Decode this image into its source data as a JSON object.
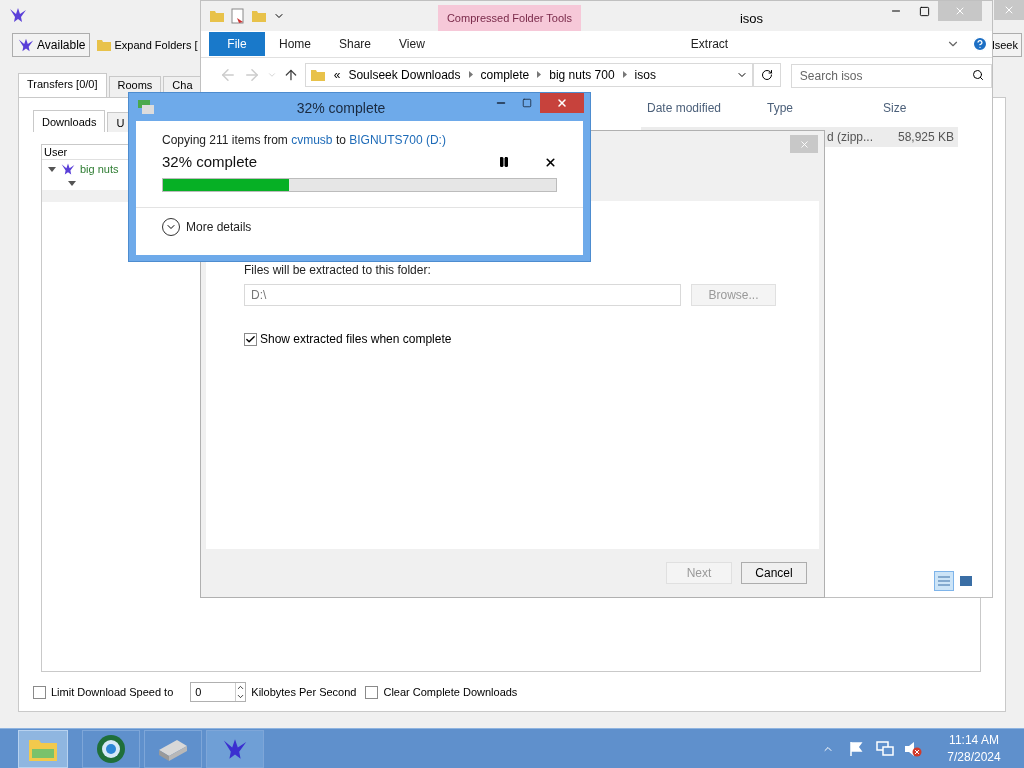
{
  "soulseek": {
    "status_button": "Available",
    "expand_button": "Expand Folders [",
    "right_button": "lseek",
    "tabs": [
      {
        "label": "Transfers [0/0]",
        "selected": true
      },
      {
        "label": "Rooms",
        "selected": false
      },
      {
        "label": "Cha",
        "selected": false
      }
    ],
    "subtabs": [
      {
        "label": "Downloads",
        "selected": true
      },
      {
        "label": "U",
        "selected": false
      }
    ],
    "table": {
      "columns": [
        "User"
      ],
      "rows": [
        {
          "user": "big nuts",
          "expanded": true,
          "children": [
            {
              "expanded": true
            }
          ]
        }
      ]
    },
    "limit_speed": {
      "label": "Limit Download Speed to",
      "checked": false
    },
    "speed_value": "0",
    "speed_unit": "Kilobytes Per Second",
    "clear_complete": {
      "label": "Clear Complete Downloads",
      "checked": false
    }
  },
  "explorer": {
    "title": "isos",
    "contextual_group": "Compressed Folder Tools",
    "ribbon_tabs": [
      {
        "label": "File",
        "kind": "file"
      },
      {
        "label": "Home",
        "kind": "tab"
      },
      {
        "label": "Share",
        "kind": "tab"
      },
      {
        "label": "View",
        "kind": "tab"
      },
      {
        "label": "Extract",
        "kind": "contextual"
      }
    ],
    "breadcrumb": [
      "«",
      "Soulseek Downloads",
      "complete",
      "big nuts 700",
      "isos"
    ],
    "search": {
      "placeholder": "Search isos"
    },
    "columns": [
      "Date modified",
      "Type",
      "Size"
    ],
    "row": {
      "type": "d (zipp...",
      "size": "58,925 KB"
    },
    "views": [
      {
        "kind": "details",
        "selected": true
      },
      {
        "kind": "large_icons",
        "selected": false
      }
    ]
  },
  "extract_wizard": {
    "prompt": "Files will be extracted to this folder:",
    "path": "D:\\",
    "browse": {
      "label": "Browse...",
      "disabled": true
    },
    "show_files": {
      "label": "Show extracted files when complete",
      "checked": true
    },
    "buttons": [
      {
        "label": "Next",
        "disabled": true
      },
      {
        "label": "Cancel",
        "disabled": false
      }
    ]
  },
  "copy_dialog": {
    "title": "32% complete",
    "message": {
      "prefix": "Copying 211 items from",
      "source": "cvmusb",
      "middle": "to",
      "destination": "BIGNUTS700 (D:)"
    },
    "status": "32% complete",
    "level": 0.32,
    "more_details": "More details"
  },
  "taskbar": {
    "time": "11:14 AM",
    "date": "7/28/2024"
  }
}
